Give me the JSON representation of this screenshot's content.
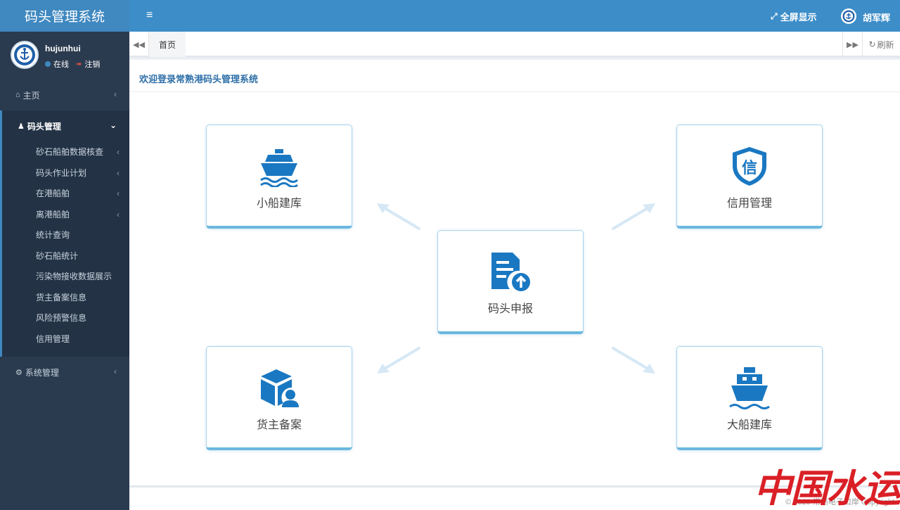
{
  "app": {
    "title": "码头管理系统"
  },
  "sidebar": {
    "user": {
      "name": "hujunhui",
      "status": "在线",
      "logout": "注销"
    },
    "home": "主页",
    "dock_mgmt": "码头管理",
    "sub_items": [
      {
        "label": "砂石船舶数据核查",
        "has_children": true
      },
      {
        "label": "码头作业计划",
        "has_children": true
      },
      {
        "label": "在港船舶",
        "has_children": true
      },
      {
        "label": "离港船舶",
        "has_children": true
      },
      {
        "label": "统计查询",
        "has_children": false
      },
      {
        "label": "砂石船统计",
        "has_children": false
      },
      {
        "label": "污染物接收数据展示",
        "has_children": false
      },
      {
        "label": "货主备案信息",
        "has_children": false
      },
      {
        "label": "风险预警信息",
        "has_children": false
      },
      {
        "label": "信用管理",
        "has_children": false
      }
    ],
    "system_mgmt": "系统管理"
  },
  "header": {
    "fullscreen": "全屏显示",
    "user": "胡军辉"
  },
  "tabs": {
    "home": "首页",
    "refresh": "刷新"
  },
  "content": {
    "welcome": "欢迎登录常熟港码头管理系统",
    "cards": {
      "small_ship": "小船建库",
      "credit": "信用管理",
      "dock_report": "码头申报",
      "cargo_owner": "货主备案",
      "big_ship": "大船建库"
    }
  },
  "footer": {
    "copyright": "© 2020 常熟电子口岸 Copyright"
  },
  "watermark": "中国水运报",
  "colors": {
    "primary": "#3c8dc8",
    "sidebar": "#2b3b4f",
    "icon": "#1a78c2"
  }
}
